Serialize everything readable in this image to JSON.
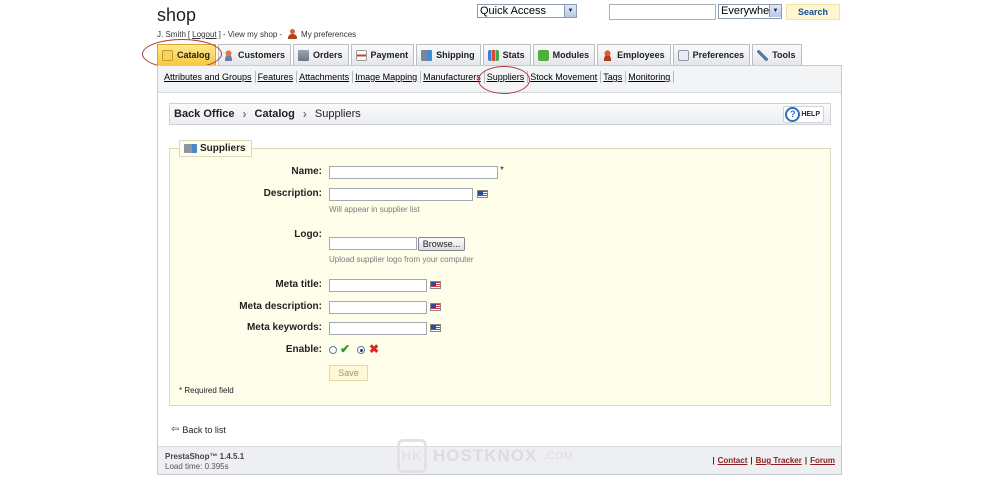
{
  "header": {
    "shop_title": "shop",
    "user_name": "J. Smith",
    "logout_label": "Logout",
    "view_shop_label": "View my shop",
    "preferences_label": "My preferences",
    "quick_access_label": "Quick Access",
    "search_scope": "Everywhere",
    "search_button": "Search"
  },
  "tabs": [
    {
      "label": "Catalog",
      "icon": "catalog-icon",
      "active": true
    },
    {
      "label": "Customers",
      "icon": "customers-icon"
    },
    {
      "label": "Orders",
      "icon": "orders-icon"
    },
    {
      "label": "Payment",
      "icon": "payment-icon"
    },
    {
      "label": "Shipping",
      "icon": "shipping-icon"
    },
    {
      "label": "Stats",
      "icon": "stats-icon"
    },
    {
      "label": "Modules",
      "icon": "modules-icon"
    },
    {
      "label": "Employees",
      "icon": "employees-icon"
    },
    {
      "label": "Preferences",
      "icon": "preferences-icon"
    },
    {
      "label": "Tools",
      "icon": "tools-icon"
    }
  ],
  "subnav": [
    "Attributes and Groups",
    "Features",
    "Attachments",
    "Image Mapping",
    "Manufacturers",
    "Suppliers",
    "Stock Movement",
    "Tags",
    "Monitoring"
  ],
  "breadcrumb": {
    "root": "Back Office",
    "section": "Catalog",
    "current": "Suppliers",
    "help_label": "HELP"
  },
  "form": {
    "legend": "Suppliers",
    "name_label": "Name:",
    "required_star": "*",
    "description_label": "Description:",
    "description_hint": "Will appear in supplier list",
    "logo_label": "Logo:",
    "browse_label": "Browse...",
    "logo_hint": "Upload supplier logo from your computer",
    "meta_title_label": "Meta title:",
    "meta_description_label": "Meta description:",
    "meta_keywords_label": "Meta keywords:",
    "enable_label": "Enable:",
    "save_label": "Save",
    "required_note": "* Required field"
  },
  "back_to_list": "Back to list",
  "footer": {
    "version": "PrestaShop™ 1.4.5.1",
    "load_time": "Load time: 0.395s",
    "links": [
      "Contact",
      "Bug Tracker",
      "Forum"
    ]
  },
  "watermark": {
    "text": "HOSTKNOX",
    "suffix": ".COM",
    "badge": "HK"
  },
  "colors": {
    "active_tab": "#f7c93e",
    "annotation_circle": "#b23a3a",
    "fieldset_bg": "#fffeeb"
  }
}
